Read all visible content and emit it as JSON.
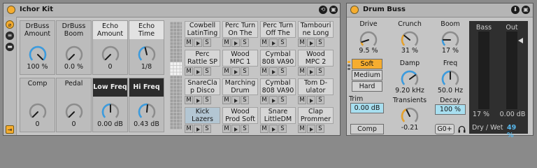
{
  "rack": {
    "title": "Ichor Kit",
    "colors": {
      "accent": "#f6ad2f",
      "selected_chain": "#b3c6d3",
      "dark_macro": "#2c2c2c"
    },
    "icons": [
      "hot-swap-icon",
      "map-icon"
    ],
    "side_icons": [
      "macro-view-icon",
      "chain-list-icon",
      "device-view-icon",
      "macro-map-icon"
    ],
    "macros": [
      {
        "name": "DrBuss Amount",
        "value": "100 %",
        "fill": 1.0
      },
      {
        "name": "DrBuss Boom",
        "value": "0.0 %",
        "fill": 0.0
      },
      {
        "name": "Echo Amount",
        "value": "0",
        "fill": 0.0
      },
      {
        "name": "Echo Time",
        "value": "1/8",
        "fill": 0.45
      },
      {
        "name": "Comp",
        "value": "0",
        "fill": 0.0
      },
      {
        "name": "Pedal",
        "value": "0",
        "fill": 0.0
      },
      {
        "name": "Low Freq",
        "value": "0.00 dB",
        "fill": 0.5
      },
      {
        "name": "Hi Freq",
        "value": "0.43 dB",
        "fill": 0.52
      }
    ],
    "chains": [
      {
        "name": "Cowbell LatinTing"
      },
      {
        "name": "Perc Turn On The"
      },
      {
        "name": "Perc Turn Off The"
      },
      {
        "name": "Tambouri ne Long"
      },
      {
        "name": "Perc Rattle SP"
      },
      {
        "name": "Wood MPC 1"
      },
      {
        "name": "Cymbal 808 VA90"
      },
      {
        "name": "Wood MPC 2"
      },
      {
        "name": "SnareCla p Disco"
      },
      {
        "name": "Marching Drum"
      },
      {
        "name": "Cymbal 808 VA90"
      },
      {
        "name": "Tom D-ulator"
      },
      {
        "name": "Kick Lazers",
        "selected": true
      },
      {
        "name": "Wood Prod Soft"
      },
      {
        "name": "Snare LittleDM"
      },
      {
        "name": "Clap Prommer"
      }
    ],
    "mute_label": "M",
    "solo_label": "S"
  },
  "buss": {
    "title": "Drum Buss",
    "drive": {
      "label": "Drive",
      "value": "9.5 %",
      "fill": 0.1
    },
    "modes": [
      "Soft",
      "Medium",
      "Hard"
    ],
    "active_mode": "Soft",
    "trim": {
      "label": "Trim",
      "value": "0.00 dB"
    },
    "comp_label": "Comp",
    "crunch": {
      "label": "Crunch",
      "value": "31 %",
      "fill": 0.31
    },
    "damp": {
      "label": "Damp",
      "value": "9.20 kHz",
      "fill": 0.7
    },
    "transients": {
      "label": "Transients",
      "value": "-0.21",
      "fill": 0.4
    },
    "boom": {
      "label": "Boom",
      "value": "17 %",
      "fill": 0.17
    },
    "freq": {
      "label": "Freq",
      "value": "50.0 Hz",
      "fill": 0.5
    },
    "decay": {
      "label": "Decay",
      "value": "100 %"
    },
    "g0_label": "G0+",
    "bass": {
      "label": "Bass",
      "value": "17 %"
    },
    "out": {
      "label": "Out",
      "value": "0.00 dB"
    },
    "drywet": {
      "label": "Dry / Wet",
      "value": "49 %"
    }
  }
}
